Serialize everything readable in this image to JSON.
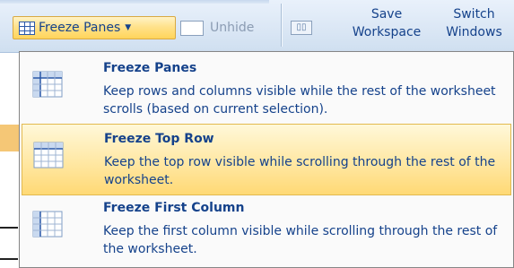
{
  "ribbon": {
    "freeze_panes_button": "Freeze Panes",
    "unhide_button": "Unhide",
    "save_workspace_line1": "Save",
    "save_workspace_line2": "Workspace",
    "switch_windows_line1": "Switch",
    "switch_windows_line2": "Windows"
  },
  "menu": {
    "items": [
      {
        "title": "Freeze Panes",
        "description": "Keep rows and columns visible while the rest of the worksheet scrolls (based on current selection).",
        "highlighted": false,
        "icon": "freeze-panes-icon"
      },
      {
        "title": "Freeze Top Row",
        "description": "Keep the top row visible while scrolling through the rest of the worksheet.",
        "highlighted": true,
        "icon": "freeze-top-row-icon"
      },
      {
        "title": "Freeze First Column",
        "description": "Keep the first column visible while scrolling through the rest of the worksheet.",
        "highlighted": false,
        "icon": "freeze-first-column-icon"
      }
    ]
  },
  "colors": {
    "text_blue": "#15428b",
    "highlight": "#ffd975",
    "ribbon": "#dbe7f5"
  }
}
